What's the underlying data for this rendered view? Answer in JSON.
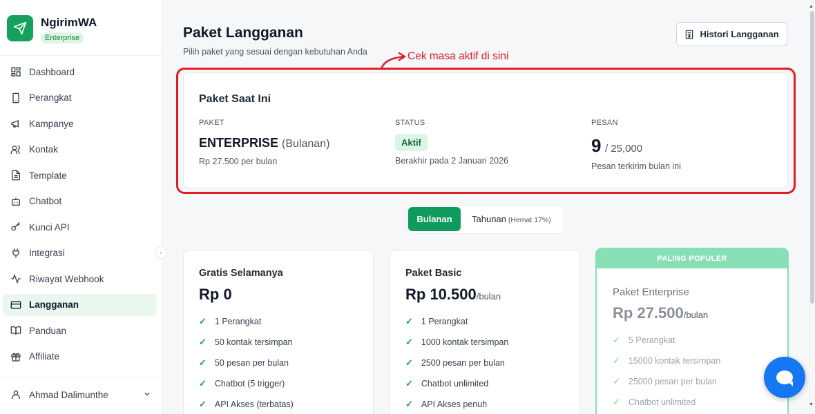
{
  "brand": {
    "name": "NgirimWA",
    "badge": "Enterprise"
  },
  "sidebar": {
    "items": [
      {
        "label": "Dashboard",
        "icon": "grid-icon"
      },
      {
        "label": "Perangkat",
        "icon": "phone-icon"
      },
      {
        "label": "Kampanye",
        "icon": "megaphone-icon"
      },
      {
        "label": "Kontak",
        "icon": "users-icon"
      },
      {
        "label": "Template",
        "icon": "file-icon"
      },
      {
        "label": "Chatbot",
        "icon": "bot-icon"
      },
      {
        "label": "Kunci API",
        "icon": "key-icon"
      },
      {
        "label": "Integrasi",
        "icon": "plug-icon"
      },
      {
        "label": "Riwayat Webhook",
        "icon": "activity-icon"
      },
      {
        "label": "Langganan",
        "icon": "credit-card-icon",
        "active": true
      },
      {
        "label": "Panduan",
        "icon": "book-icon"
      },
      {
        "label": "Affiliate",
        "icon": "gift-icon"
      }
    ],
    "user": {
      "name": "Ahmad Dalimunthe"
    }
  },
  "header": {
    "title": "Paket Langganan",
    "subtitle": "Pilih paket yang sesuai dengan kebutuhan Anda",
    "history_button": "Histori Langganan"
  },
  "annotation": {
    "text": "Cek masa aktif di sini",
    "color": "#e11d24"
  },
  "current_plan": {
    "title": "Paket Saat Ini",
    "plan_label": "PAKET",
    "plan_name": "ENTERPRISE",
    "plan_period": "(Bulanan)",
    "plan_price": "Rp 27.500 per bulan",
    "status_label": "STATUS",
    "status": "Aktif",
    "expiry": "Berakhir pada 2 Januari 2026",
    "messages_label": "PESAN",
    "messages_used": "9",
    "messages_limit": "/ 25,000",
    "messages_note": "Pesan terkirim bulan ini"
  },
  "billing_toggle": {
    "monthly": "Bulanan",
    "yearly": "Tahunan",
    "yearly_note": "(Hemat 17%)",
    "selected": "Bulanan"
  },
  "plans": [
    {
      "name": "Gratis Selamanya",
      "price": "Rp 0",
      "unit": "",
      "features": [
        "1 Perangkat",
        "50 kontak tersimpan",
        "50 pesan per bulan",
        "Chatbot (5 trigger)",
        "API Akses (terbatas)"
      ]
    },
    {
      "name": "Paket Basic",
      "price": "Rp 10.500",
      "unit": "/bulan",
      "features": [
        "1 Perangkat",
        "1000 kontak tersimpan",
        "2500 pesan per bulan",
        "Chatbot unlimited",
        "API Akses penuh"
      ]
    },
    {
      "name": "Paket Enterprise",
      "price": "Rp 27.500",
      "unit": "/bulan",
      "badge": "PALING POPULER",
      "features": [
        "5 Perangkat",
        "15000 kontak tersimpan",
        "25000 pesan per bulan",
        "Chatbot unlimited"
      ]
    }
  ],
  "colors": {
    "primary": "#0f9b5e",
    "accent_light": "#86dfb5",
    "annotation": "#e11d24",
    "chat": "#1677f2"
  }
}
